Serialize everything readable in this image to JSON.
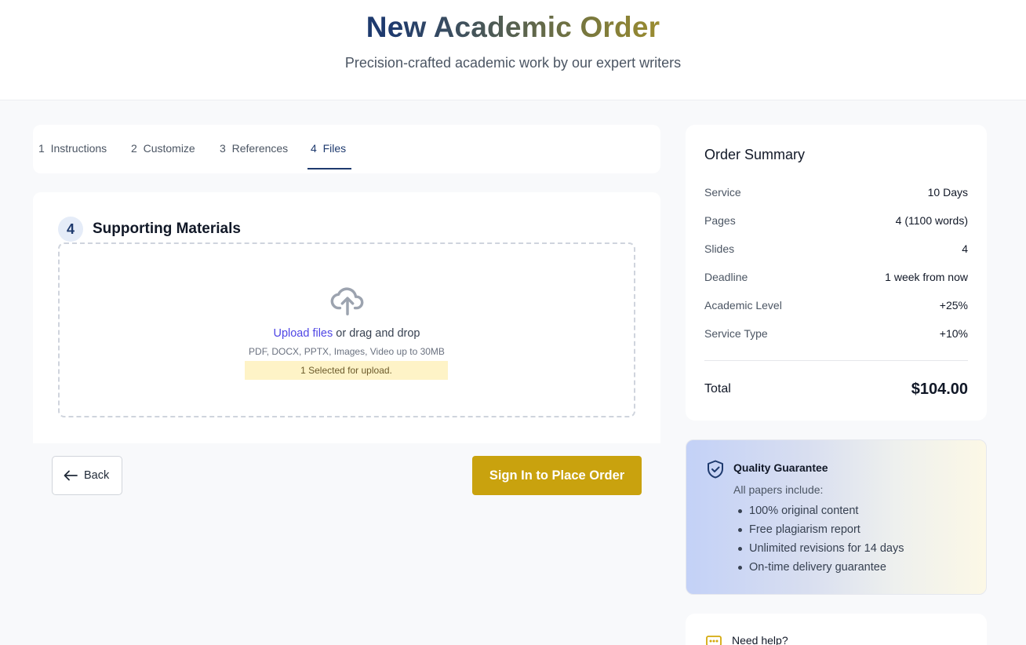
{
  "header": {
    "title": "New Academic Order",
    "subtitle": "Precision-crafted academic work by our expert writers"
  },
  "tabs": [
    {
      "number": "1",
      "label": "Instructions"
    },
    {
      "number": "2",
      "label": "Customize"
    },
    {
      "number": "3",
      "label": "References"
    },
    {
      "number": "4",
      "label": "Files",
      "active": true
    }
  ],
  "files_section": {
    "step": "4",
    "title": "Supporting Materials",
    "upload_link": "Upload files",
    "upload_text": " or drag and drop",
    "hint": "PDF, DOCX, PPTX, Images, Video up to 30MB",
    "selected_status": "1 Selected for upload.",
    "icon": "cloud-upload-icon"
  },
  "actions": {
    "back_label": "Back",
    "place_order_label": "Sign In to Place Order"
  },
  "summary": {
    "title": "Order Summary",
    "rows": [
      {
        "label": "Service",
        "value": "10 Days"
      },
      {
        "label": "Pages",
        "value": "4 (1100 words)"
      },
      {
        "label": "Slides",
        "value": "4"
      },
      {
        "label": "Deadline",
        "value": "1 week from now"
      },
      {
        "label": "Academic Level",
        "value": "+25%"
      },
      {
        "label": "Service Type",
        "value": "+10%"
      }
    ],
    "total_label": "Total",
    "total_value": "$104.00"
  },
  "guarantee": {
    "title": "Quality Guarantee",
    "subtitle": "All papers include:",
    "items": [
      "100% original content",
      "Free plagiarism report",
      "Unlimited revisions for 14 days",
      "On-time delivery guarantee"
    ],
    "icon": "shield-check-icon"
  },
  "help": {
    "label": "Need help?",
    "icon": "chat-icon"
  },
  "colors": {
    "primary": "#1e3a6e",
    "accent": "#c9a20e",
    "link": "#4f46e5"
  }
}
